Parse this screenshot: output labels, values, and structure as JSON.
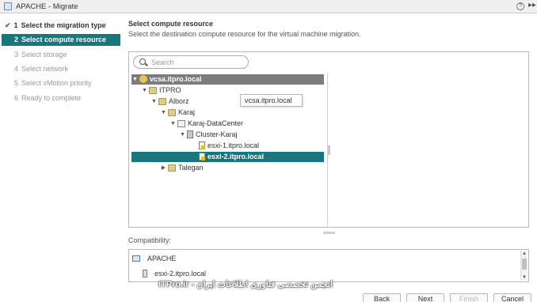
{
  "window": {
    "title": "APACHE - Migrate",
    "help_label": "?",
    "expand_label": "▸▸"
  },
  "steps": [
    {
      "num": "1",
      "label": "Select the migration type",
      "status": "done"
    },
    {
      "num": "2",
      "label": "Select compute resource",
      "status": "active"
    },
    {
      "num": "3",
      "label": "Select storage",
      "status": "pending"
    },
    {
      "num": "4",
      "label": "Select network",
      "status": "pending"
    },
    {
      "num": "5",
      "label": "Select vMotion priority",
      "status": "pending"
    },
    {
      "num": "6",
      "label": "Ready to complete",
      "status": "pending"
    }
  ],
  "page": {
    "title": "Select compute resource",
    "description": "Select the destination compute resource for the virtual machine migration."
  },
  "search": {
    "placeholder": "Search",
    "value": ""
  },
  "tree": [
    {
      "label": "vcsa.itpro.local",
      "icon": "vcenter-icon",
      "toggle": "▼",
      "state": "root"
    },
    {
      "label": "ITPRO",
      "icon": "folder-icon",
      "toggle": "▼",
      "state": ""
    },
    {
      "label": "Alborz",
      "icon": "folder-icon",
      "toggle": "▼",
      "state": ""
    },
    {
      "label": "Karaj",
      "icon": "folder-icon",
      "toggle": "▼",
      "state": ""
    },
    {
      "label": "Karaj-DataCenter",
      "icon": "datacenter-icon",
      "toggle": "▼",
      "state": ""
    },
    {
      "label": "Cluster-Karaj",
      "icon": "cluster-icon",
      "toggle": "▼",
      "state": ""
    },
    {
      "label": "esxi-1.itpro.local",
      "icon": "host-icon",
      "toggle": "",
      "state": ""
    },
    {
      "label": "esxi-2.itpro.local",
      "icon": "host-icon",
      "toggle": "",
      "state": "selected"
    },
    {
      "label": "Talegan",
      "icon": "folder-icon",
      "toggle": "▶",
      "state": ""
    }
  ],
  "tooltip": {
    "text": "vcsa.itpro.local"
  },
  "compatibility": {
    "label": "Compatibility:",
    "items": [
      {
        "icon": "vm-icon",
        "text": "APACHE"
      },
      {
        "icon": "server-icon",
        "text": "esxi-2.itpro.local"
      }
    ]
  },
  "watermark": "ITPro.ir - انجمن تخصصی فناوری اطلاعات ایران",
  "buttons": {
    "back": "Back",
    "next": "Next",
    "finish": "Finish",
    "cancel": "Cancel"
  },
  "colors": {
    "accent": "#17777d",
    "root_row": "#7d7d7d",
    "check": "#2f8c3a"
  }
}
